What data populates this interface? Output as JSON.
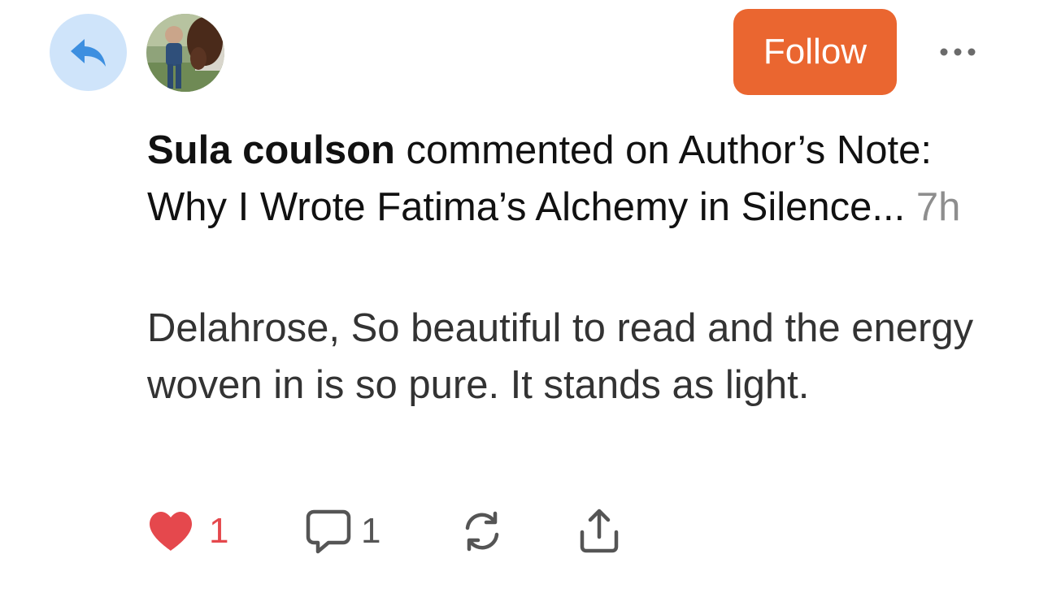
{
  "header": {
    "reply_icon": "reply-arrow-icon",
    "avatar_icon": "user-avatar-photo",
    "follow_label": "Follow",
    "more_icon": "ellipsis-icon"
  },
  "activity": {
    "author_name": "Sula coulson",
    "action_text": " commented on ",
    "post_title": "Author’s Note: Why I Wrote Fatima’s Alchemy in Silence...",
    "timestamp": "7h"
  },
  "comment": {
    "text": "Delahrose, So beautiful to read and the energy woven in is so pure. It stands as light."
  },
  "actions": {
    "like_icon": "heart-filled-icon",
    "like_count": "1",
    "comment_icon": "speech-bubble-icon",
    "comment_count": "1",
    "restack_icon": "refresh-icon",
    "share_icon": "share-icon"
  },
  "colors": {
    "accent": "#ea6630",
    "reply_badge_bg": "#cfe4fa",
    "reply_icon": "#3d8fe0",
    "like": "#e5484d",
    "muted": "#8e8e8e"
  }
}
